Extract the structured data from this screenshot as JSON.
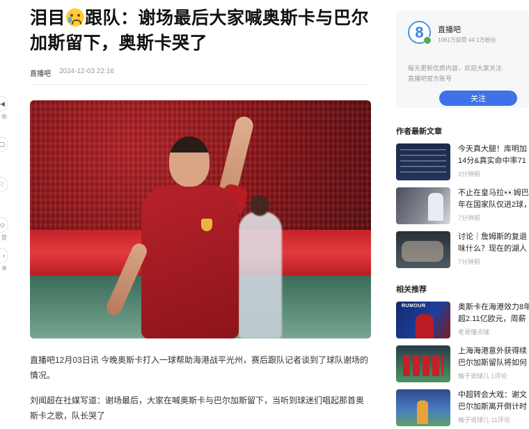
{
  "article": {
    "title_prefix": "泪目",
    "title_suffix": "跟队：谢场最后大家喊奥斯卡与巴尔加斯留下，奥斯卡哭了",
    "title_emoji": "crying-face-emoji",
    "author": "直播吧",
    "date": "2024-12-03 22:16",
    "hero_image_alt": "Oscar celebrating, pointing upward in Shanghai Port red jersey",
    "hero_sponsor_text": "SAIC MOTOR",
    "paragraphs": [
      "直播吧12月03日讯 今晚奥斯卡打入一球帮助海港战平光州，赛后跟队记者谈到了球队谢场的情况。",
      "刘闻超在社媒写道：谢场最后，大家在喊奥斯卡与巴尔加斯留下，当听到球迷们唱起那首奥斯卡之歌，队长哭了"
    ]
  },
  "sharebar": {
    "items": [
      {
        "icon": "audio-icon",
        "label": "收"
      },
      {
        "icon": "comment-icon",
        "label": ""
      },
      {
        "icon": "like-icon",
        "label": ""
      },
      {
        "icon": "thumb-up-icon",
        "label": "赞"
      },
      {
        "icon": "share-icon",
        "label": "享"
      }
    ]
  },
  "author_card": {
    "name": "直播吧",
    "stats": "1061万获赞 44.1万粉丝",
    "desc_line1": "每天更新优质内容，欢迎大家关注",
    "desc_line2": "直播吧官方账号",
    "follow_label": "关注",
    "accent_color": "#3d73e6"
  },
  "latest": {
    "title": "作者最新文章",
    "items": [
      {
        "headline_l1": "今天真大腿！库明加",
        "headline_l2": "14分&真实命中率71",
        "sub": "3分钟前"
      },
      {
        "headline_l1": "不止在皇马拉👀姆巴",
        "headline_l2": "年在国家队仅进2球，",
        "sub": "7分钟前"
      },
      {
        "headline_l1": "讨论｜詹姆斯的复退",
        "headline_l2": "味什么？现在的湖人",
        "sub": "7分钟前"
      }
    ]
  },
  "related": {
    "title": "相关推荐",
    "items": [
      {
        "headline_l1": "奥斯卡在海港效力8年",
        "headline_l2": "超2.11亿欧元，周薪",
        "sub": "老哥懂点球",
        "thumb_text": "RUMOUR"
      },
      {
        "headline_l1": "上海海港意外获得续",
        "headline_l2": "巴尔加斯留队将如何",
        "sub": "柚子说球儿  1评论"
      },
      {
        "headline_l1": "中超转会大戏：谢文",
        "headline_l2": "巴尔加斯离开倒计时",
        "sub": "柚子说球儿  11评论"
      }
    ]
  }
}
